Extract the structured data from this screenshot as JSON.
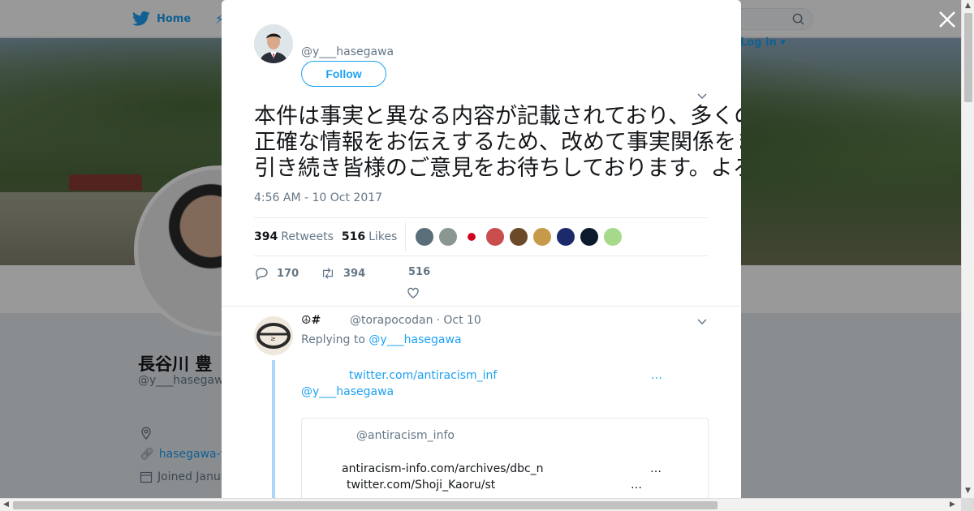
{
  "nav": {
    "home_label": "Home",
    "login_label": "Log in"
  },
  "profile": {
    "name": "長谷川 豊",
    "handle": "@y___hasegawa",
    "link": "hasegawa-y",
    "joined": "Joined Janua"
  },
  "tweet": {
    "handle": "@y___hasegawa",
    "follow_label": "Follow",
    "text": "本件は事実と異なる内容が記載されており、多くの方々が誤解されています。本当に申し訳ございません。前回の記者会見でもお伝えしましたが、\n正確な情報をお伝えするため、改めて事実関係をまとめた資料を作成中です。何卒ご理解ください…。\n引き続き皆様のご意見をお待ちしております。よろしくお願いします。",
    "date": "4:56 AM - 10 Oct 2017",
    "retweets_count": "394",
    "retweets_label": "Retweets",
    "likes_count": "516",
    "likes_label": "Likes",
    "likers": [
      "#5a6e7a",
      "#8a9690",
      "#ffffff",
      "#c94d4d",
      "#6b4a2a",
      "#c59a4a",
      "#1c2a6b",
      "#0d1a2e",
      "#a6d98a"
    ],
    "reply_count": "170",
    "retweet_count": "394",
    "like_count": "516"
  },
  "reply": {
    "emoji": "☮#",
    "handle": "@torapocodan",
    "time": "· Oct 10",
    "replying_prefix": "Replying to",
    "replying_to": "@y___hasegawa",
    "link1": "twitter.com/antiracism_inf",
    "ellipsis": "…",
    "mention": "@y___hasegawa",
    "quote": {
      "handle": "@antiracism_info",
      "line1": "antiracism-info.com/archives/dbc_n",
      "line2": "twitter.com/Shoji_Kaoru/st",
      "ellipsis": "…"
    }
  },
  "colors": {
    "accent": "#1da1f2",
    "muted": "#657786",
    "text": "#14171a"
  }
}
